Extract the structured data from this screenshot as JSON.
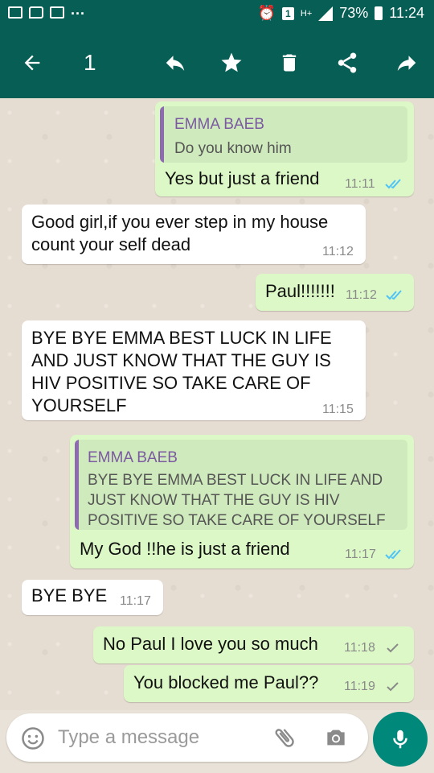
{
  "status_bar": {
    "battery": "73%",
    "time": "11:24",
    "badge": "1",
    "network": "H+"
  },
  "toolbar": {
    "selected_count": "1"
  },
  "messages": [
    {
      "dir": "out",
      "quote_name": "EMMA BAEB",
      "quote_text": "Do you know him",
      "text": "Yes but just a friend",
      "time": "11:11",
      "status": "read"
    },
    {
      "dir": "in",
      "text": "Good girl,if you ever step in my house count your self dead",
      "time": "11:12"
    },
    {
      "dir": "out",
      "text": "Paul!!!!!!!",
      "time": "11:12",
      "status": "read"
    },
    {
      "dir": "in",
      "text": "BYE BYE EMMA BEST LUCK IN LIFE AND JUST KNOW THAT THE GUY IS HIV POSITIVE  SO TAKE CARE OF YOURSELF",
      "time": "11:15"
    },
    {
      "dir": "out",
      "quote_name": "EMMA BAEB",
      "quote_text": "BYE BYE EMMA BEST LUCK IN LIFE AND JUST KNOW THAT THE GUY IS HIV POSITIVE  SO TAKE CARE OF YOURSELF",
      "text": "My God !!he is just a friend",
      "time": "11:17",
      "status": "read"
    },
    {
      "dir": "in",
      "text": "BYE BYE",
      "time": "11:17"
    },
    {
      "dir": "out",
      "text": "No Paul I love you so much",
      "time": "11:18",
      "status": "sent"
    },
    {
      "dir": "out",
      "text": "You blocked  me Paul??",
      "time": "11:19",
      "status": "sent"
    }
  ],
  "composer": {
    "placeholder": "Type a message"
  },
  "colors": {
    "header": "#075e54",
    "outgoing": "#dcf8c6",
    "incoming": "#ffffff",
    "read_ticks": "#4fc3f7",
    "mic_button": "#00897b"
  },
  "icons": [
    "back-arrow-icon",
    "reply-icon",
    "star-icon",
    "delete-icon",
    "share-icon",
    "forward-icon",
    "emoji-icon",
    "attach-icon",
    "camera-icon",
    "mic-icon"
  ]
}
